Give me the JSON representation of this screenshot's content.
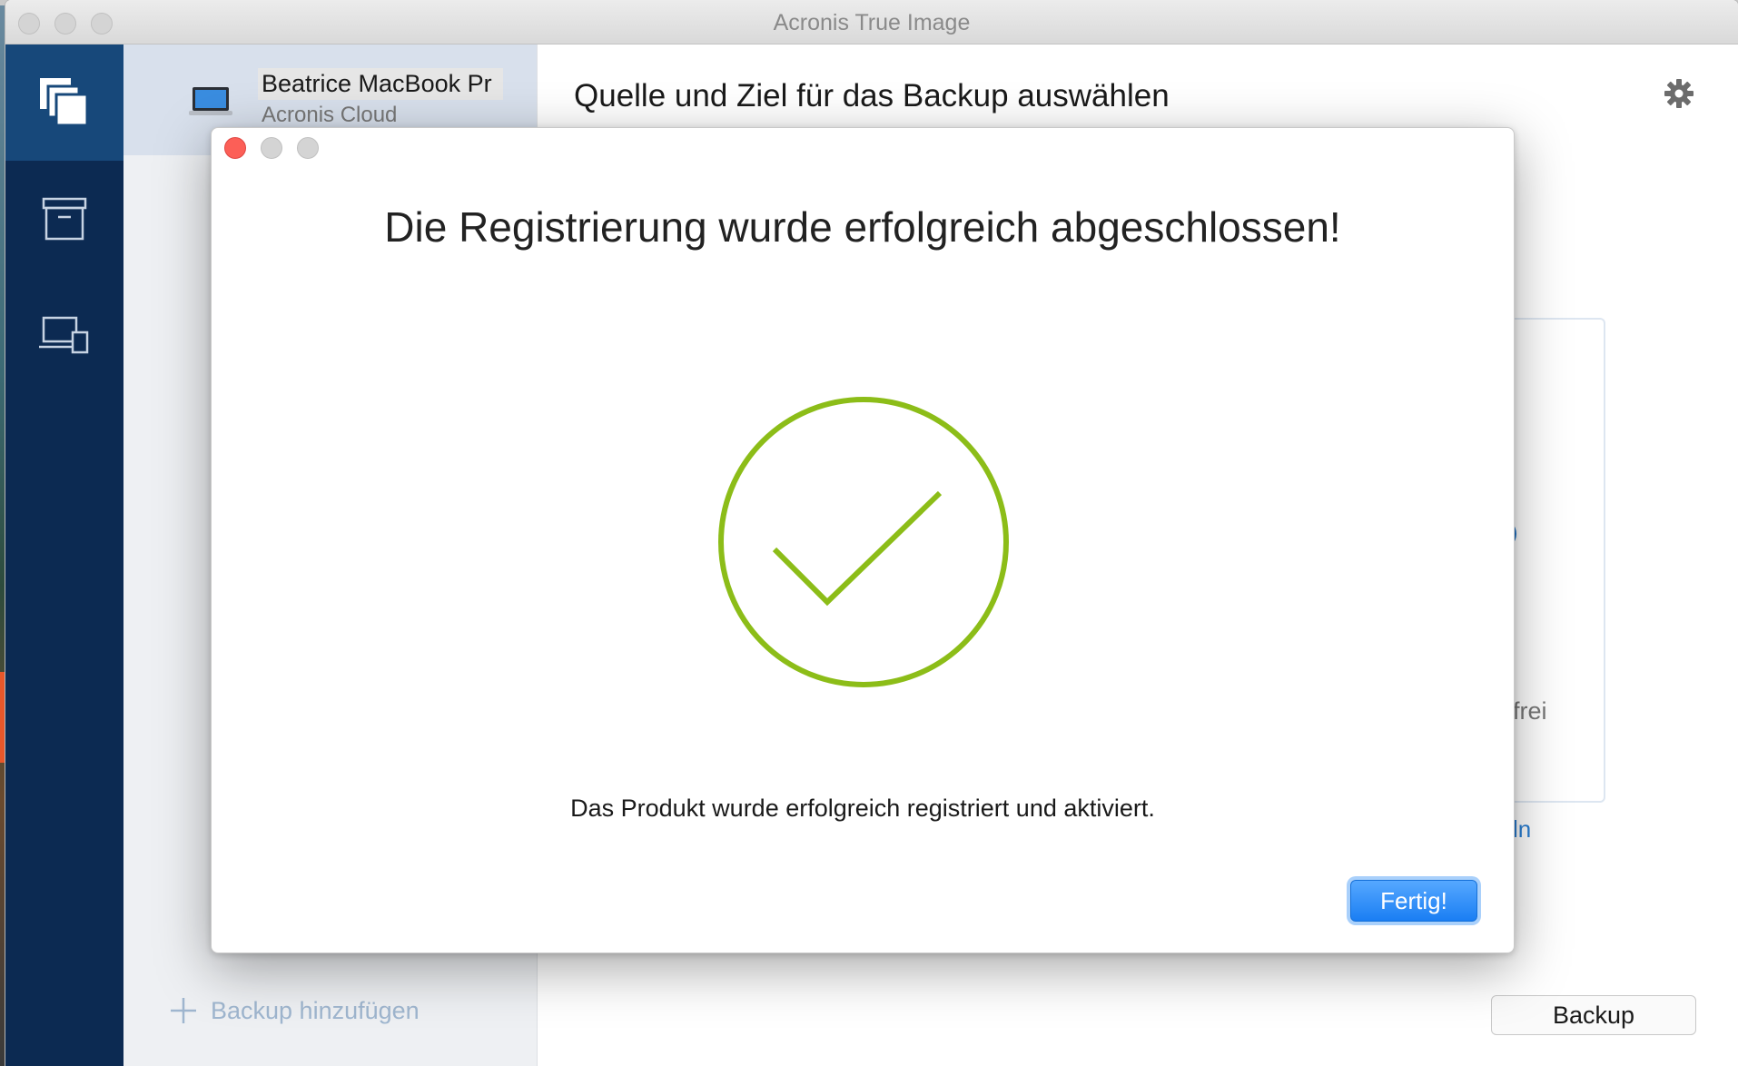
{
  "window": {
    "title": "Acronis True Image"
  },
  "sidebar": {
    "items": [
      {
        "icon": "backup-copies-icon",
        "active": true
      },
      {
        "icon": "archive-box-icon",
        "active": false
      },
      {
        "icon": "devices-icon",
        "active": false
      }
    ]
  },
  "backup_list": {
    "selected": {
      "name": "Beatrice MacBook Pr",
      "destination": "Acronis Cloud",
      "icon": "laptop-icon"
    },
    "add_label": "Backup hinzufügen"
  },
  "main": {
    "title": "Quelle und Ziel für das Backup auswählen",
    "partial_text_free": "frei",
    "partial_text_link": "ln",
    "backup_button": "Backup"
  },
  "dialog": {
    "heading": "Die Registrierung wurde erfolgreich abgeschlossen!",
    "icon": "success-check-icon",
    "message": "Das Produkt wurde erfolgreich registriert und aktiviert.",
    "done_button": "Fertig!"
  },
  "colors": {
    "nav_bg": "#0c2a52",
    "nav_active": "#17487a",
    "success_green": "#8cbd18",
    "primary_blue": "#1a7ef3",
    "close_red": "#fc5f57"
  }
}
